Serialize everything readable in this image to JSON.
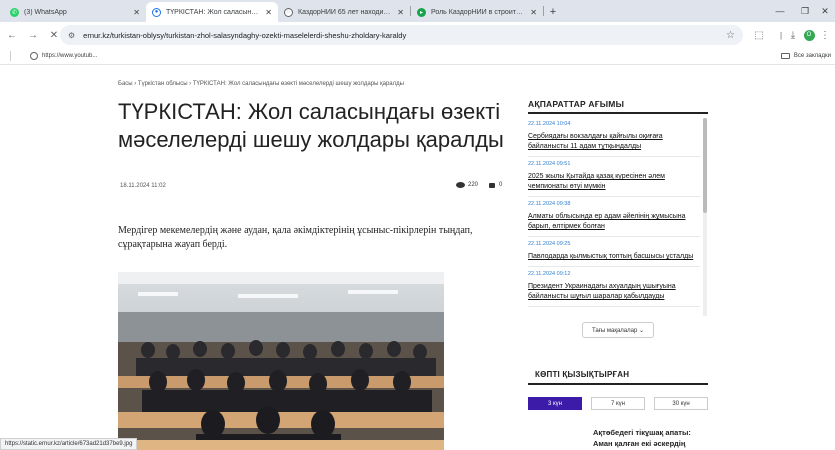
{
  "tabs": [
    {
      "label": "(3) WhatsApp",
      "color": "#25d366",
      "active": false
    },
    {
      "label": "ТҮРКІСТАН: Жол саласындағы",
      "color": "#1a73e8",
      "active": true
    },
    {
      "label": "КаздорНИИ 65 лет находится",
      "color": "#5f6368",
      "active": false
    },
    {
      "label": "Роль КаздорНИИ в строительс",
      "color": "#16a34a",
      "active": false
    }
  ],
  "toolbar": {
    "url": "ernur.kz/turkistan-oblysy/turkistan-zhol-salasyndaghy-ozekti-maselelerdi-sheshu-zholdary-karaldy",
    "avatar_letter": "O"
  },
  "bookmarks": {
    "item1": "https://www.youtub...",
    "all": "Все закладки"
  },
  "article": {
    "breadcrumb": "Басы › Түркістан облысы › ТҮРКІСТАН: Жол саласындағы өзекті мәселелерді шешу жолдары қаралды",
    "title": "ТҮРКІСТАН: Жол саласындағы өзекті мәселелерді шешу жолдары қаралды",
    "date": "18.11.2024 11:02",
    "views": "220",
    "comments": "0",
    "lead": "Мердігер мекемелердің және аудан, қала әкімдіктерінің ұсыныс-пікірлерін тыңдап, сұрақтарына жауап берді."
  },
  "news": {
    "heading": "АҚПАРАТТАР АҒЫМЫ",
    "items": [
      {
        "time": "22.11.2024 10:04",
        "title": "Сербиядағы вокзалдағы қайғылы оқиғаға байланысты 11 адам тұтқындалды"
      },
      {
        "time": "22.11.2024 09:51",
        "title": "2025 жылы Қытайда қазақ күресінен әлем чемпионаты өтуі мүмкін"
      },
      {
        "time": "22.11.2024 09:38",
        "title": "Алматы облысында ер адам әйелінің жұмысына барып, өлтірмек болған"
      },
      {
        "time": "22.11.2024 09:25",
        "title": "Павлодарда қылмыстық топтың басшысы ұсталды"
      },
      {
        "time": "22.11.2024 09:12",
        "title": "Президент Украинадағы ахуалдың ушығуына байланысты шұғыл шаралар қабылдауды"
      }
    ],
    "more": "Тағы мақалалар ⌄"
  },
  "popular": {
    "heading": "КӨПТІ ҚЫЗЫҚТЫРҒАН",
    "tabs": [
      "3 күн",
      "7 күн",
      "30 күн"
    ],
    "item": "Ақтөбедегі тікұшақ апаты: Аман қалған екі әскердің"
  },
  "status": "https://static.ernur.kz/article/673ad21d37be9.jpg"
}
